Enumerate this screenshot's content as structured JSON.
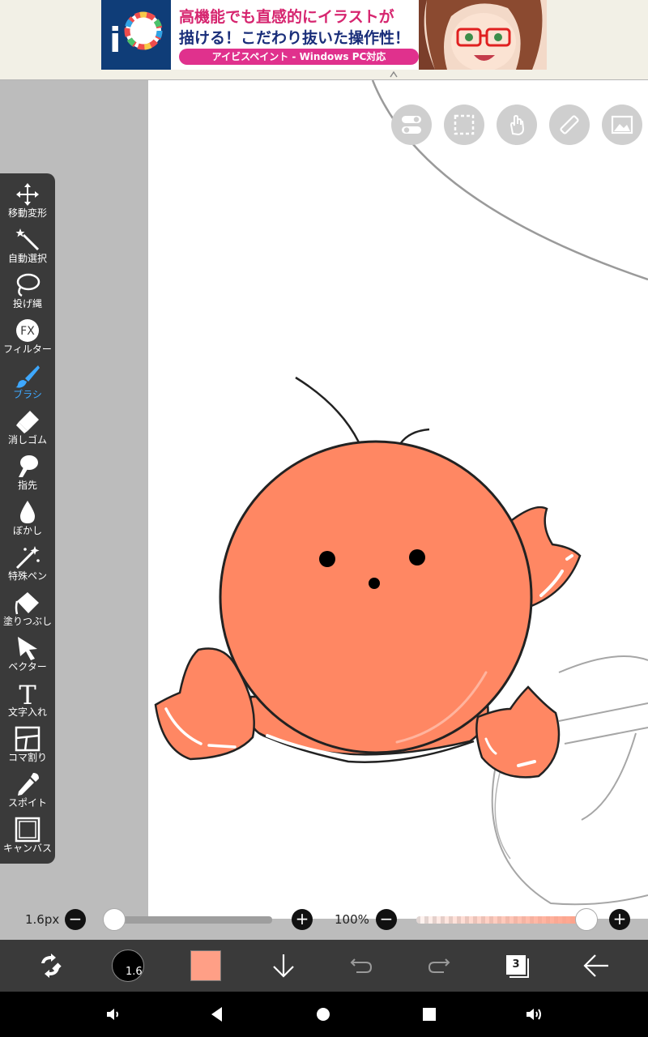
{
  "ad": {
    "headline_line1": "高機能でも直感的にイラストが",
    "headline_line2": "描ける！こだわり抜いた操作性！",
    "pill_text": "アイビスペイント - Windows PC対応"
  },
  "tools": [
    {
      "id": "move",
      "label": "移動変形"
    },
    {
      "id": "magic",
      "label": "自動選択"
    },
    {
      "id": "lasso",
      "label": "投げ縄"
    },
    {
      "id": "filter",
      "label": "フィルター",
      "icon_text": "FX"
    },
    {
      "id": "brush",
      "label": "ブラシ",
      "active": true
    },
    {
      "id": "eraser",
      "label": "消しゴム"
    },
    {
      "id": "smudge",
      "label": "指先"
    },
    {
      "id": "blur",
      "label": "ぼかし"
    },
    {
      "id": "special",
      "label": "特殊ペン"
    },
    {
      "id": "fill",
      "label": "塗りつぶし"
    },
    {
      "id": "vector",
      "label": "ベクター"
    },
    {
      "id": "text",
      "label": "文字入れ",
      "icon_text": "T"
    },
    {
      "id": "frame",
      "label": "コマ割り"
    },
    {
      "id": "eyedropper",
      "label": "スポイト"
    },
    {
      "id": "canvas",
      "label": "キャンバス"
    }
  ],
  "sliders": {
    "size_label": "1.6px",
    "size_value": 0.0,
    "opacity_label": "100%",
    "opacity_value": 1.0
  },
  "bottom": {
    "brush_size_text": "1.6",
    "color": "#ff9f86",
    "layer_count": "3"
  },
  "colors": {
    "accent": "#3ea8ff",
    "fill_orange": "#ff8763"
  }
}
